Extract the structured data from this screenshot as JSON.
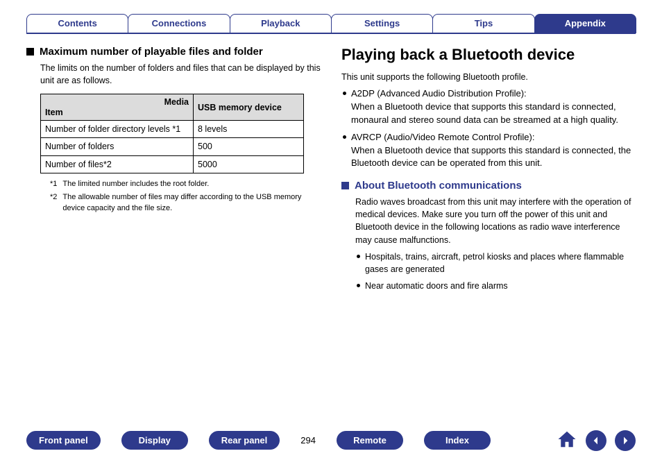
{
  "tabs": [
    {
      "label": "Contents",
      "active": false
    },
    {
      "label": "Connections",
      "active": false
    },
    {
      "label": "Playback",
      "active": false
    },
    {
      "label": "Settings",
      "active": false
    },
    {
      "label": "Tips",
      "active": false
    },
    {
      "label": "Appendix",
      "active": true
    }
  ],
  "left": {
    "heading": "Maximum number of playable files and folder",
    "intro": "The limits on the number of folders and files that can be displayed by this unit are as follows.",
    "table": {
      "corner_label_media": "Media",
      "corner_label_item": "Item",
      "col_header": "USB memory device",
      "rows": [
        {
          "item": "Number of folder directory levels *1",
          "value": "8 levels"
        },
        {
          "item": "Number of folders",
          "value": "500"
        },
        {
          "item": "Number of files*2",
          "value": "5000"
        }
      ]
    },
    "footnotes": [
      {
        "mark": "*1",
        "text": "The limited number includes the root folder."
      },
      {
        "mark": "*2",
        "text": "The allowable number of files may differ according to the USB memory device capacity and the file size."
      }
    ]
  },
  "right": {
    "title": "Playing back a Bluetooth device",
    "intro": "This unit supports the following Bluetooth profile.",
    "profiles": [
      {
        "name": "A2DP (Advanced Audio Distribution Profile):",
        "desc": "When a Bluetooth device that supports this standard is connected, monaural and stereo sound data can be streamed at a high quality."
      },
      {
        "name": "AVRCP (Audio/Video Remote Control Profile):",
        "desc": "When a Bluetooth device that supports this standard is connected, the Bluetooth device can be operated from this unit."
      }
    ],
    "sub_heading": "About Bluetooth communications",
    "sub_intro": "Radio waves broadcast from this unit may interfere with the operation of medical devices. Make sure you turn off the power of this unit and Bluetooth device in the following locations as radio wave interference may cause malfunctions.",
    "sub_items": [
      "Hospitals, trains, aircraft, petrol kiosks and places where flammable gases are generated",
      "Near automatic doors and fire alarms"
    ]
  },
  "footer": {
    "buttons": [
      "Front panel",
      "Display",
      "Rear panel"
    ],
    "page_number": "294",
    "buttons2": [
      "Remote",
      "Index"
    ]
  }
}
